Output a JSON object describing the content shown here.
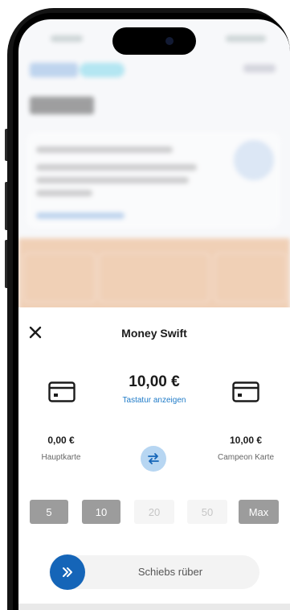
{
  "sheet": {
    "title": "Money Swift",
    "close_icon": "close-icon",
    "amount": "10,00 €",
    "keyboard_link": "Tastatur anzeigen",
    "swap_icon": "swap-arrows-icon",
    "accent_color": "#1565b8"
  },
  "source_account": {
    "amount": "0,00 €",
    "label": "Hauptkarte",
    "icon": "card-icon"
  },
  "target_account": {
    "amount": "10,00 €",
    "label": "Campeon Karte",
    "icon": "card-icon"
  },
  "quick_amounts": [
    {
      "label": "5",
      "state": "active"
    },
    {
      "label": "10",
      "state": "active"
    },
    {
      "label": "20",
      "state": "disabled"
    },
    {
      "label": "50",
      "state": "disabled"
    },
    {
      "label": "Max",
      "state": "active"
    }
  ],
  "swipe": {
    "label": "Schiebs rüber",
    "icon": "double-chevron-right-icon"
  }
}
